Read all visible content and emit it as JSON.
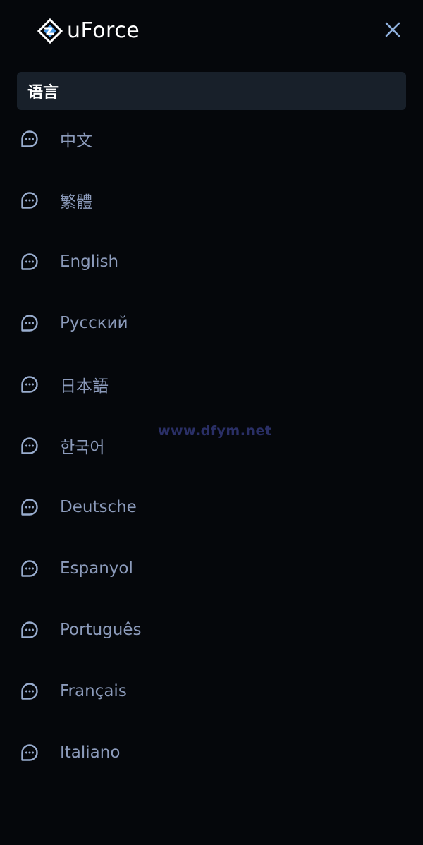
{
  "header": {
    "brand": "uForce",
    "logo_icon": "uforce-logo-icon",
    "close_icon": "close-icon"
  },
  "section": {
    "title": "语言"
  },
  "languages": [
    {
      "label": "中文",
      "icon": "chat-bubble-icon"
    },
    {
      "label": "繁體",
      "icon": "chat-bubble-icon"
    },
    {
      "label": "English",
      "icon": "chat-bubble-icon"
    },
    {
      "label": "Русский",
      "icon": "chat-bubble-icon"
    },
    {
      "label": "日本語",
      "icon": "chat-bubble-icon"
    },
    {
      "label": "한국어",
      "icon": "chat-bubble-icon"
    },
    {
      "label": "Deutsche",
      "icon": "chat-bubble-icon"
    },
    {
      "label": "Espanyol",
      "icon": "chat-bubble-icon"
    },
    {
      "label": "Português",
      "icon": "chat-bubble-icon"
    },
    {
      "label": "Français",
      "icon": "chat-bubble-icon"
    },
    {
      "label": "Italiano",
      "icon": "chat-bubble-icon"
    }
  ],
  "watermark": "www.dfym.net",
  "colors": {
    "background": "#05070b",
    "section_bg": "#18202a",
    "item_text": "#8c9bbb",
    "icon_stroke": "#9aaed0",
    "close_icon": "#8fb0dd",
    "watermark": "#2a2f66"
  }
}
